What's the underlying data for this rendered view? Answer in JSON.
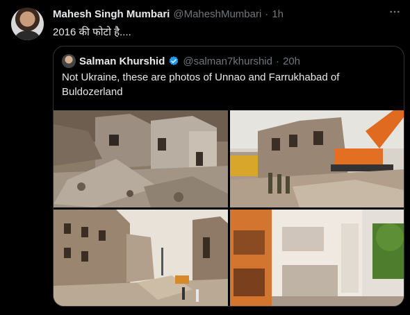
{
  "tweet": {
    "author_name": "Mahesh Singh Mumbari",
    "handle": "@MaheshMumbari",
    "separator": "·",
    "time": "1h",
    "text": "2016 की फोटो है....",
    "more_icon": "more-dots-icon"
  },
  "quoted_tweet": {
    "author_name": "Salman Khurshid",
    "verified_icon": "verified-badge-icon",
    "handle": "@salman7khurshid",
    "separator": "·",
    "time": "20h",
    "text": "Not Ukraine, these are photos of Unnao and Farrukhabad of Buldozerland"
  },
  "colors": {
    "background": "#000000",
    "text": "#e7e9ea",
    "muted": "#71767b",
    "border": "#2f3336",
    "verified": "#1d9bf0"
  }
}
